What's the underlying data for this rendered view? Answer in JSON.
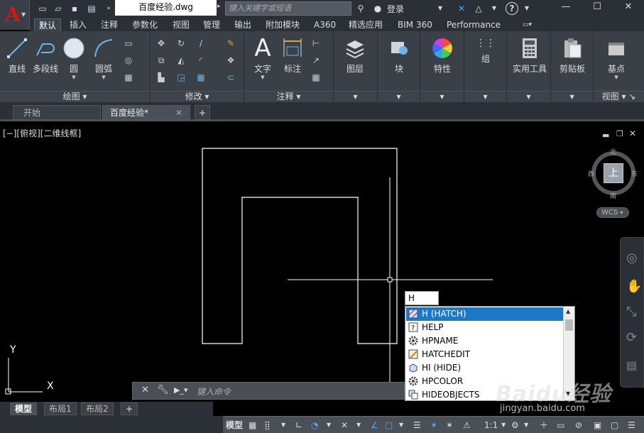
{
  "app": {
    "logo_icon": "autocad-logo-icon",
    "file_title": "百度经验.dwg",
    "search_placeholder": "键入关键字或短语",
    "login_label": "登录",
    "help_label": "?"
  },
  "ribbon_tabs": [
    "默认",
    "插入",
    "注释",
    "参数化",
    "视图",
    "管理",
    "输出",
    "附加模块",
    "A360",
    "精选应用",
    "BIM 360",
    "Performance"
  ],
  "active_tab": "默认",
  "panels": {
    "draw": {
      "title": "绘图",
      "tools": [
        "直线",
        "多段线",
        "圆",
        "圆弧"
      ]
    },
    "modify": {
      "title": "修改"
    },
    "annotation": {
      "title": "注释",
      "tools": [
        "文字",
        "标注"
      ]
    },
    "layers": {
      "label": "图层"
    },
    "block": {
      "label": "块"
    },
    "properties": {
      "label": "特性"
    },
    "group": {
      "label": "组"
    },
    "utilities": {
      "label": "实用工具"
    },
    "clipboard": {
      "label": "剪贴板"
    },
    "base": {
      "label": "基点"
    },
    "view": {
      "title": "视图"
    }
  },
  "doc_tabs": [
    {
      "label": "开始"
    },
    {
      "label": "百度经验*"
    }
  ],
  "viewport": {
    "label": "[−][俯视][二维线框]",
    "ucs_x": "X",
    "ucs_y": "Y"
  },
  "viewcube": {
    "north": "北",
    "south": "南",
    "east": "东",
    "west": "西",
    "face": "上",
    "wcs": "WCS"
  },
  "command": {
    "input_value": "H",
    "placeholder": "键入命令",
    "suggestions": [
      {
        "label": "H (HATCH)",
        "icon": "hatch-icon"
      },
      {
        "label": "HELP",
        "icon": "help-icon"
      },
      {
        "label": "HPNAME",
        "icon": "gear-icon"
      },
      {
        "label": "HATCHEDIT",
        "icon": "hatch-edit-icon"
      },
      {
        "label": "HI (HIDE)",
        "icon": "hide-icon"
      },
      {
        "label": "HPCOLOR",
        "icon": "gear-icon"
      },
      {
        "label": "HIDEOBJECTS",
        "icon": "hide-objects-icon"
      }
    ]
  },
  "layout_tabs": [
    "模型",
    "布局1",
    "布局2"
  ],
  "status": {
    "model_label": "模型",
    "scale": "1:1"
  },
  "watermark": {
    "brand": "Baidu经验",
    "url": "jingyan.baidu.com"
  }
}
